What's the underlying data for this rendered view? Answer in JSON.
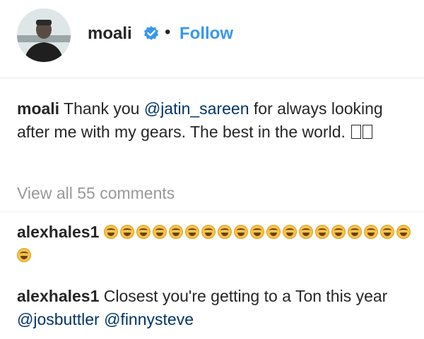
{
  "post": {
    "username": "moali",
    "dot": "•",
    "follow_label": "Follow",
    "caption": {
      "author": "moali",
      "text_before": " Thank you ",
      "mention": "@jatin_sareen",
      "text_after": " for always looking after me with my gears. The best in the world. "
    },
    "view_all": "View all 55 comments"
  },
  "comments": [
    {
      "author": "alexhales1",
      "emoji_count": 20
    },
    {
      "author": "alexhales1",
      "text": " Closest you're getting to a Ton this year ",
      "mention1": "@josbuttler",
      "mention2": "@finnysteve"
    }
  ],
  "icons": {
    "verified": "verified-badge-icon",
    "emoji": "laughing-emoji-icon",
    "unknown_glyph": "missing-glyph-icon"
  },
  "colors": {
    "link": "#3897f0",
    "mention": "#003569",
    "muted": "#999999",
    "text": "#262626"
  }
}
